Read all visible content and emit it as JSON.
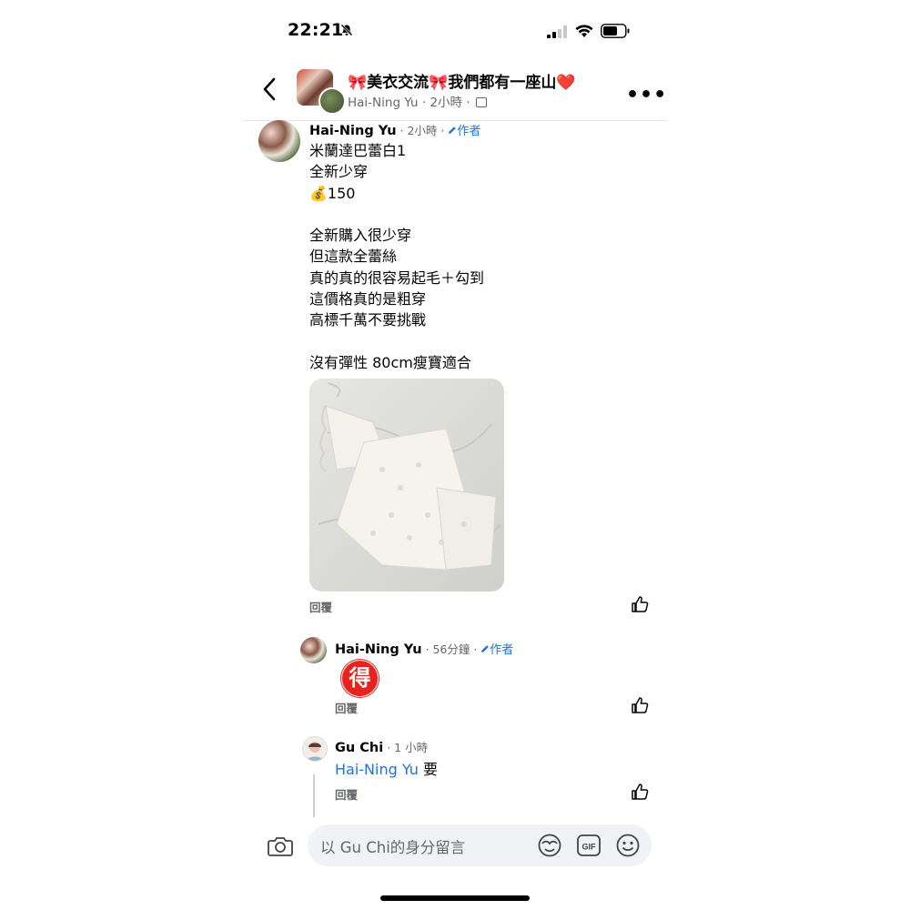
{
  "status": {
    "time": "22:21"
  },
  "header": {
    "group_title": "🎀美衣交流🎀我們都有一座山❤️",
    "subtitle": "Hai-Ning Yu · 2小時 ·"
  },
  "comments": [
    {
      "author": "Hai-Ning Yu",
      "time": " · 2小時 · ",
      "badge": "作者",
      "text": "米蘭達巴蕾白1\n全新少穿\n💰150\n\n全新購入很少穿\n但這款全蕾絲\n真的真的很容易起毛＋勾到\n這價格真的是粗穿\n高標千萬不要挑戰\n\n沒有彈性 80cm瘦寶適合",
      "photo": "white-lace-top",
      "reply_label": "回覆"
    },
    {
      "author": "Hai-Ning Yu",
      "time": " · 56分鐘 · ",
      "badge": "作者",
      "emoji": "得",
      "reply_label": "回覆"
    },
    {
      "author": "Gu Chi",
      "time": " · 1 小時",
      "mention": "Hai-Ning Yu",
      "text": " 要",
      "reply_label": "回覆"
    }
  ],
  "composer": {
    "placeholder": "以 Gu Chi的身分留言"
  },
  "icons": [
    "back-icon",
    "more-icon",
    "like-icon",
    "camera-icon",
    "sticker-icon",
    "gif-icon",
    "emoji-icon",
    "pencil-icon"
  ],
  "colors": {
    "link": "#1b74e4",
    "secondary_text": "#65676b",
    "emoji_red": "#e8231e"
  }
}
